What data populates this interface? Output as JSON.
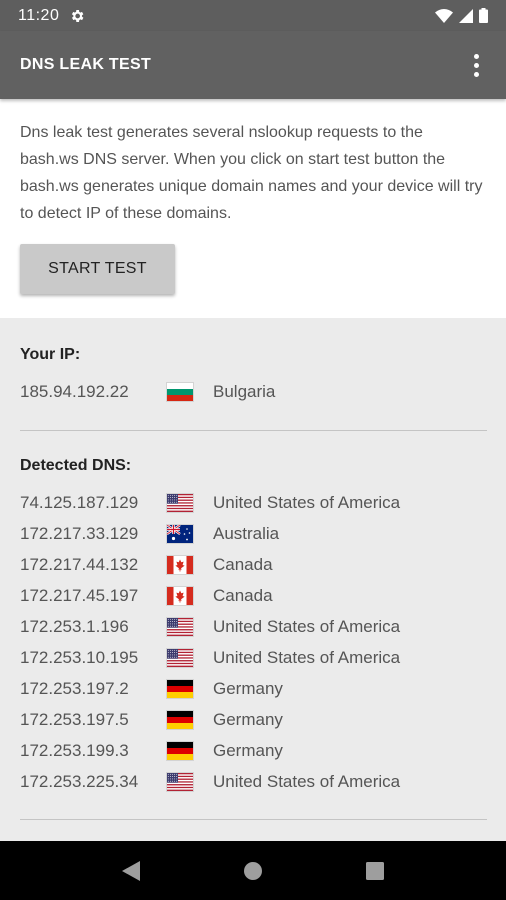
{
  "status_bar": {
    "time": "11:20"
  },
  "app_bar": {
    "title": "DNS LEAK TEST"
  },
  "intro": {
    "description": "Dns leak test generates several nslookup requests to the bash.ws DNS server. When you click on start test button the bash.ws generates unique domain names and your device will try to detect IP of these domains.",
    "start_button": "START TEST"
  },
  "your_ip": {
    "label": "Your IP:",
    "ip": "185.94.192.22",
    "flag": "bg",
    "country": "Bulgaria"
  },
  "detected_dns": {
    "label": "Detected DNS:",
    "entries": [
      {
        "ip": "74.125.187.129",
        "flag": "us",
        "country": "United States of America"
      },
      {
        "ip": "172.217.33.129",
        "flag": "au",
        "country": "Australia"
      },
      {
        "ip": "172.217.44.132",
        "flag": "ca",
        "country": "Canada"
      },
      {
        "ip": "172.217.45.197",
        "flag": "ca",
        "country": "Canada"
      },
      {
        "ip": "172.253.1.196",
        "flag": "us",
        "country": "United States of America"
      },
      {
        "ip": "172.253.10.195",
        "flag": "us",
        "country": "United States of America"
      },
      {
        "ip": "172.253.197.2",
        "flag": "de",
        "country": "Germany"
      },
      {
        "ip": "172.253.197.5",
        "flag": "de",
        "country": "Germany"
      },
      {
        "ip": "172.253.199.3",
        "flag": "de",
        "country": "Germany"
      },
      {
        "ip": "172.253.225.34",
        "flag": "us",
        "country": "United States of America"
      }
    ]
  }
}
